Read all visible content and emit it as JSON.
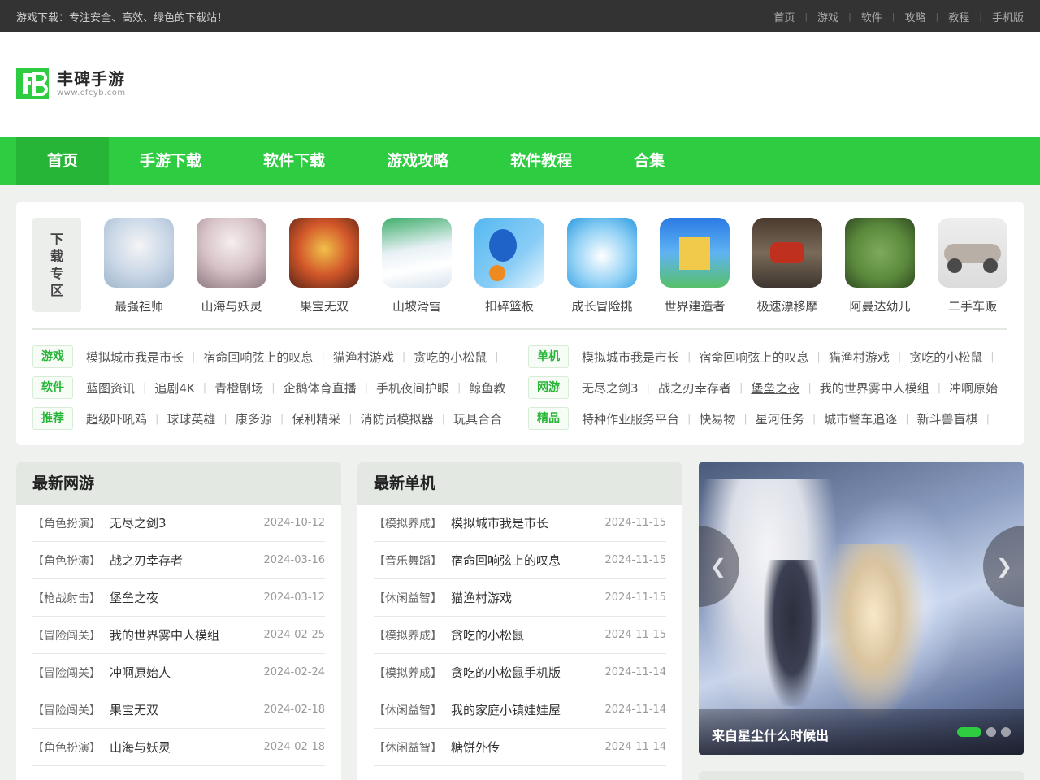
{
  "topbar": {
    "slogan": "游戏下载：专注安全、高效、绿色的下载站！",
    "links": [
      "首页",
      "游戏",
      "软件",
      "攻略",
      "教程",
      "手机版"
    ]
  },
  "logo": {
    "name": "丰碑手游",
    "url": "www.cfcyb.com"
  },
  "nav": {
    "items": [
      "首页",
      "手游下载",
      "软件下载",
      "游戏攻略",
      "软件教程",
      "合集"
    ],
    "active": 0
  },
  "download_zone": {
    "label": [
      "下",
      "载",
      "专",
      "区"
    ],
    "apps": [
      {
        "name": "最强祖师"
      },
      {
        "name": "山海与妖灵"
      },
      {
        "name": "果宝无双"
      },
      {
        "name": "山坡滑雪"
      },
      {
        "name": "扣碎篮板"
      },
      {
        "name": "成长冒险挑"
      },
      {
        "name": "世界建造者"
      },
      {
        "name": "极速漂移摩"
      },
      {
        "name": "阿曼达幼儿"
      },
      {
        "name": "二手车贩"
      }
    ],
    "tag_rows": [
      {
        "badge": "游戏",
        "links": [
          "模拟城市我是市长",
          "宿命回响弦上的叹息",
          "猫渔村游戏",
          "贪吃的小松鼠"
        ]
      },
      {
        "badge": "单机",
        "links": [
          "模拟城市我是市长",
          "宿命回响弦上的叹息",
          "猫渔村游戏",
          "贪吃的小松鼠"
        ]
      },
      {
        "badge": "软件",
        "links": [
          "蓝图资讯",
          "追剧4K",
          "青橙剧场",
          "企鹅体育直播",
          "手机夜间护眼",
          "鲸鱼教"
        ]
      },
      {
        "badge": "网游",
        "links": [
          "无尽之剑3",
          "战之刃幸存者",
          "堡垒之夜",
          "我的世界雾中人模组",
          "冲啊原始"
        ]
      },
      {
        "badge": "推荐",
        "links": [
          "超级吓吼鸡",
          "球球英雄",
          "康多源",
          "保利精采",
          "消防员模拟器",
          "玩具合合"
        ]
      },
      {
        "badge": "精品",
        "links": [
          "特种作业服务平台",
          "快易物",
          "星河任务",
          "城市警车追逐",
          "新斗兽盲棋"
        ]
      }
    ]
  },
  "latest_online": {
    "title": "最新网游",
    "rows": [
      {
        "cat": "【角色扮演】",
        "title": "无尽之剑3",
        "date": "2024-10-12"
      },
      {
        "cat": "【角色扮演】",
        "title": "战之刃幸存者",
        "date": "2024-03-16"
      },
      {
        "cat": "【枪战射击】",
        "title": "堡垒之夜",
        "date": "2024-03-12"
      },
      {
        "cat": "【冒险闯关】",
        "title": "我的世界雾中人模组",
        "date": "2024-02-25"
      },
      {
        "cat": "【冒险闯关】",
        "title": "冲啊原始人",
        "date": "2024-02-24"
      },
      {
        "cat": "【冒险闯关】",
        "title": "果宝无双",
        "date": "2024-02-18"
      },
      {
        "cat": "【角色扮演】",
        "title": "山海与妖灵",
        "date": "2024-02-18"
      }
    ]
  },
  "latest_single": {
    "title": "最新单机",
    "rows": [
      {
        "cat": "【模拟养成】",
        "title": "模拟城市我是市长",
        "date": "2024-11-15"
      },
      {
        "cat": "【音乐舞蹈】",
        "title": "宿命回响弦上的叹息",
        "date": "2024-11-15"
      },
      {
        "cat": "【休闲益智】",
        "title": "猫渔村游戏",
        "date": "2024-11-15"
      },
      {
        "cat": "【模拟养成】",
        "title": "贪吃的小松鼠",
        "date": "2024-11-15"
      },
      {
        "cat": "【模拟养成】",
        "title": "贪吃的小松鼠手机版",
        "date": "2024-11-14"
      },
      {
        "cat": "【休闲益智】",
        "title": "我的家庭小镇娃娃屋",
        "date": "2024-11-14"
      },
      {
        "cat": "【休闲益智】",
        "title": "糖饼外传",
        "date": "2024-11-14"
      }
    ]
  },
  "banner": {
    "caption": "来自星尘什么时候出",
    "slide_count": 3,
    "active_slide": 0
  },
  "colors": {
    "accent": "#2ecc40",
    "accent_dark": "#26b536",
    "topbar": "#333333"
  }
}
